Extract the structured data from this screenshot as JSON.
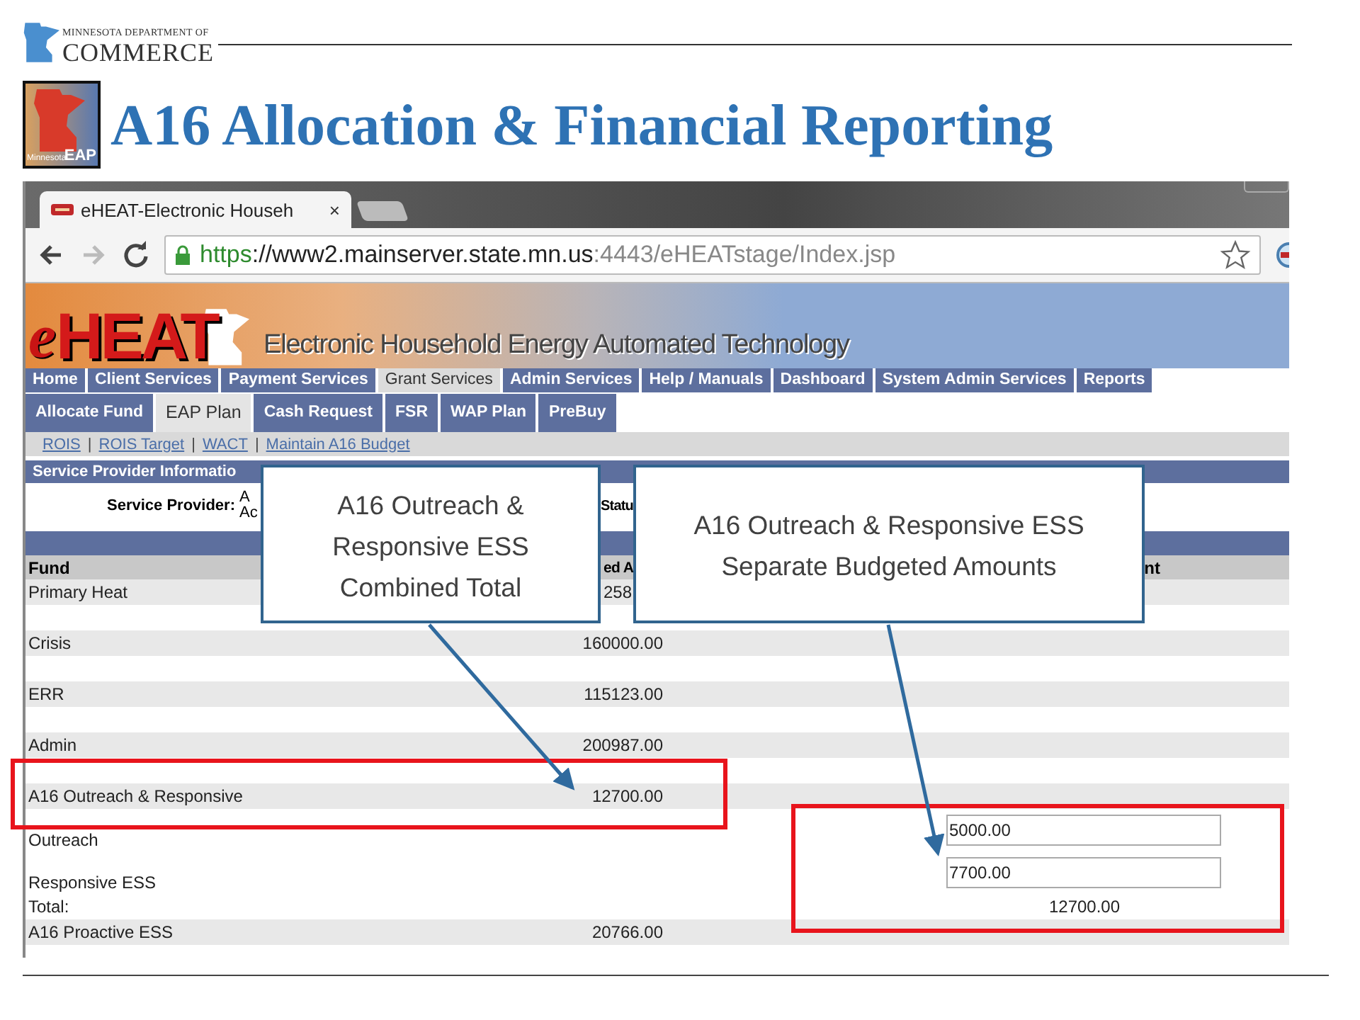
{
  "header": {
    "org_line1": "MINNESOTA DEPARTMENT OF",
    "org_line2": "COMMERCE"
  },
  "logo": {
    "small": "Minnesota",
    "big": "EAP"
  },
  "slide_title": "A16 Allocation & Financial Reporting",
  "browser": {
    "tab_title": "eHEAT-Electronic Househ",
    "tab_close": "×",
    "url_parts": [
      {
        "kind": "scheme",
        "text": "https"
      },
      {
        "kind": "host",
        "text": "://www2.mainserver.state.mn.us"
      },
      {
        "kind": "rest",
        "text": ":4443/eHEATstage/Index.jsp"
      }
    ]
  },
  "banner": {
    "logo_e": "e",
    "logo_main": "HEAT",
    "tagline": "Electronic Household Energy Automated Technology"
  },
  "nav": [
    {
      "label": "Home",
      "selected": false
    },
    {
      "label": "Client Services",
      "selected": false
    },
    {
      "label": "Payment Services",
      "selected": false
    },
    {
      "label": "Grant Services",
      "selected": true
    },
    {
      "label": "Admin Services",
      "selected": false
    },
    {
      "label": "Help / Manuals",
      "selected": false
    },
    {
      "label": "Dashboard",
      "selected": false
    },
    {
      "label": "System Admin Services",
      "selected": false
    },
    {
      "label": "Reports",
      "selected": false
    }
  ],
  "subnav": [
    {
      "label": "Allocate Fund",
      "selected": false
    },
    {
      "label": "EAP Plan",
      "selected": true
    },
    {
      "label": "Cash Request",
      "selected": false
    },
    {
      "label": "FSR",
      "selected": false
    },
    {
      "label": "WAP Plan",
      "selected": false
    },
    {
      "label": "PreBuy",
      "selected": false
    }
  ],
  "links": {
    "separator": "|",
    "items": [
      "ROIS",
      "ROIS Target",
      "WACT",
      "Maintain A16 Budget"
    ]
  },
  "section": {
    "title": "Service Provider Informatio",
    "provider_label": "Service Provider:",
    "provider_value": [
      "A",
      "Ac"
    ],
    "status_label": "Statu"
  },
  "table": {
    "columns": [
      "Fund",
      "ed A",
      "nt"
    ],
    "rows": [
      {
        "kind": "fund",
        "fund": "Primary Heat",
        "amount": "258"
      },
      {
        "kind": "fund",
        "fund": "Crisis",
        "amount": "160000.00"
      },
      {
        "kind": "fund",
        "fund": "ERR",
        "amount": "115123.00"
      },
      {
        "kind": "fund",
        "fund": "Admin",
        "amount": "200987.00"
      },
      {
        "kind": "fund",
        "fund": "A16 Outreach & Responsive",
        "amount": "12700.00"
      },
      {
        "kind": "input",
        "fund": "Outreach",
        "value": "5000.00"
      },
      {
        "kind": "input",
        "fund": "Responsive ESS",
        "value": "7700.00"
      },
      {
        "kind": "total",
        "fund": "Total:",
        "value": "12700.00"
      },
      {
        "kind": "fund",
        "fund": "A16 Proactive ESS",
        "amount": "20766.00"
      }
    ]
  },
  "callouts": [
    {
      "text": "A16 Outreach &\nResponsive ESS\nCombined Total"
    },
    {
      "text": "A16 Outreach & Responsive ESS\nSeparate Budgeted Amounts"
    }
  ]
}
